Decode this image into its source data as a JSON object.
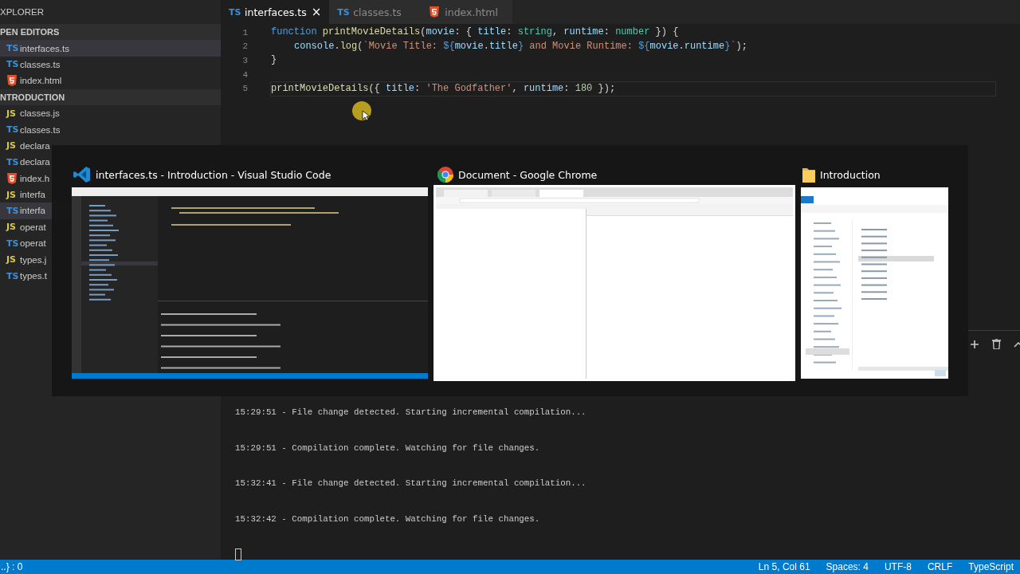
{
  "sidebar": {
    "title": "XPLORER",
    "sections": [
      {
        "title": "PEN EDITORS",
        "items": [
          {
            "badge": "TS",
            "kind": "ts",
            "name": "interfaces.ts",
            "selected": true
          },
          {
            "badge": "TS",
            "kind": "ts",
            "name": "classes.ts",
            "selected": false
          },
          {
            "kind": "html",
            "name": "index.html",
            "selected": false
          }
        ]
      },
      {
        "title": "NTRODUCTION",
        "items": [
          {
            "badge": "JS",
            "kind": "js",
            "name": "classes.js",
            "selected": false
          },
          {
            "badge": "TS",
            "kind": "ts",
            "name": "classes.ts",
            "selected": false
          },
          {
            "badge": "JS",
            "kind": "js",
            "name": "declara",
            "selected": false
          },
          {
            "badge": "TS",
            "kind": "ts",
            "name": "declara",
            "selected": false
          },
          {
            "kind": "html",
            "name": "index.h",
            "selected": false
          },
          {
            "badge": "JS",
            "kind": "js",
            "name": "interfa",
            "selected": false
          },
          {
            "badge": "TS",
            "kind": "ts",
            "name": "interfa",
            "selected": true
          },
          {
            "badge": "JS",
            "kind": "js",
            "name": "operat",
            "selected": false
          },
          {
            "badge": "TS",
            "kind": "ts",
            "name": "operat",
            "selected": false
          },
          {
            "badge": "JS",
            "kind": "js",
            "name": "types.j",
            "selected": false
          },
          {
            "badge": "TS",
            "kind": "ts",
            "name": "types.t",
            "selected": false
          }
        ]
      }
    ]
  },
  "tabs": [
    {
      "badge": "TS",
      "kind": "ts",
      "label": "interfaces.ts",
      "selected": true,
      "close": "×"
    },
    {
      "badge": "TS",
      "kind": "ts",
      "label": "classes.ts",
      "selected": false
    },
    {
      "kind": "html",
      "label": "index.html",
      "selected": false
    }
  ],
  "editor": {
    "lines": [
      {
        "number": "1",
        "current": false,
        "tokens": [
          {
            "text": "function ",
            "kind": "keyword"
          },
          {
            "text": "printMovieDetails",
            "kind": "fn"
          },
          {
            "text": "(",
            "kind": "plain"
          },
          {
            "text": "movie",
            "kind": "var"
          },
          {
            "text": ": { ",
            "kind": "plain"
          },
          {
            "text": "title",
            "kind": "var"
          },
          {
            "text": ": ",
            "kind": "plain"
          },
          {
            "text": "string",
            "kind": "type"
          },
          {
            "text": ", ",
            "kind": "plain"
          },
          {
            "text": "runtime",
            "kind": "var"
          },
          {
            "text": ": ",
            "kind": "plain"
          },
          {
            "text": "number",
            "kind": "type"
          },
          {
            "text": " }) {",
            "kind": "plain"
          }
        ]
      },
      {
        "number": "2",
        "current": false,
        "indent": true,
        "tokens": [
          {
            "text": "console",
            "kind": "var"
          },
          {
            "text": ".",
            "kind": "plain"
          },
          {
            "text": "log",
            "kind": "fn"
          },
          {
            "text": "(",
            "kind": "plain"
          },
          {
            "text": "`Movie Title: ",
            "kind": "string"
          },
          {
            "text": "${",
            "kind": "keyword"
          },
          {
            "text": "movie",
            "kind": "var"
          },
          {
            "text": ".",
            "kind": "plain"
          },
          {
            "text": "title",
            "kind": "var"
          },
          {
            "text": "}",
            "kind": "keyword"
          },
          {
            "text": " and Movie Runtime: ",
            "kind": "string"
          },
          {
            "text": "${",
            "kind": "keyword"
          },
          {
            "text": "movie",
            "kind": "var"
          },
          {
            "text": ".",
            "kind": "plain"
          },
          {
            "text": "runtime",
            "kind": "var"
          },
          {
            "text": "}",
            "kind": "keyword"
          },
          {
            "text": "`",
            "kind": "string"
          },
          {
            "text": ");",
            "kind": "plain"
          }
        ]
      },
      {
        "number": "3",
        "current": false,
        "tokens": [
          {
            "text": "}",
            "kind": "plain"
          }
        ]
      },
      {
        "number": "4",
        "current": false
      },
      {
        "number": "5",
        "current": true,
        "tokens": [
          {
            "text": "printMovieDetails",
            "kind": "fn"
          },
          {
            "text": "({ ",
            "kind": "plain"
          },
          {
            "text": "title",
            "kind": "var"
          },
          {
            "text": ": ",
            "kind": "plain"
          },
          {
            "text": "'The Godfather'",
            "kind": "string"
          },
          {
            "text": ", ",
            "kind": "plain"
          },
          {
            "text": "runtime",
            "kind": "var"
          },
          {
            "text": ": ",
            "kind": "plain"
          },
          {
            "text": "180",
            "kind": "number"
          },
          {
            "text": " });",
            "kind": "plain"
          }
        ]
      }
    ]
  },
  "terminal": {
    "lines": [
      "15:29:51 - File change detected. Starting incremental compilation...",
      "15:29:51 - Compilation complete. Watching for file changes.",
      "15:32:41 - File change detected. Starting incremental compilation...",
      "15:32:42 - Compilation complete. Watching for file changes."
    ]
  },
  "task_switcher": {
    "windows": [
      {
        "kind": "vscode",
        "title": "interfaces.ts - Introduction - Visual Studio Code",
        "selected": false
      },
      {
        "kind": "chrome",
        "title": "Document - Google Chrome",
        "selected": true
      },
      {
        "kind": "explorer",
        "title": "Introduction",
        "selected": false
      }
    ]
  },
  "status_bar": {
    "left": "..} : 0",
    "right": [
      "Ln 5, Col 61",
      "Spaces: 4",
      "UTF-8",
      "CRLF",
      "TypeScript"
    ]
  }
}
